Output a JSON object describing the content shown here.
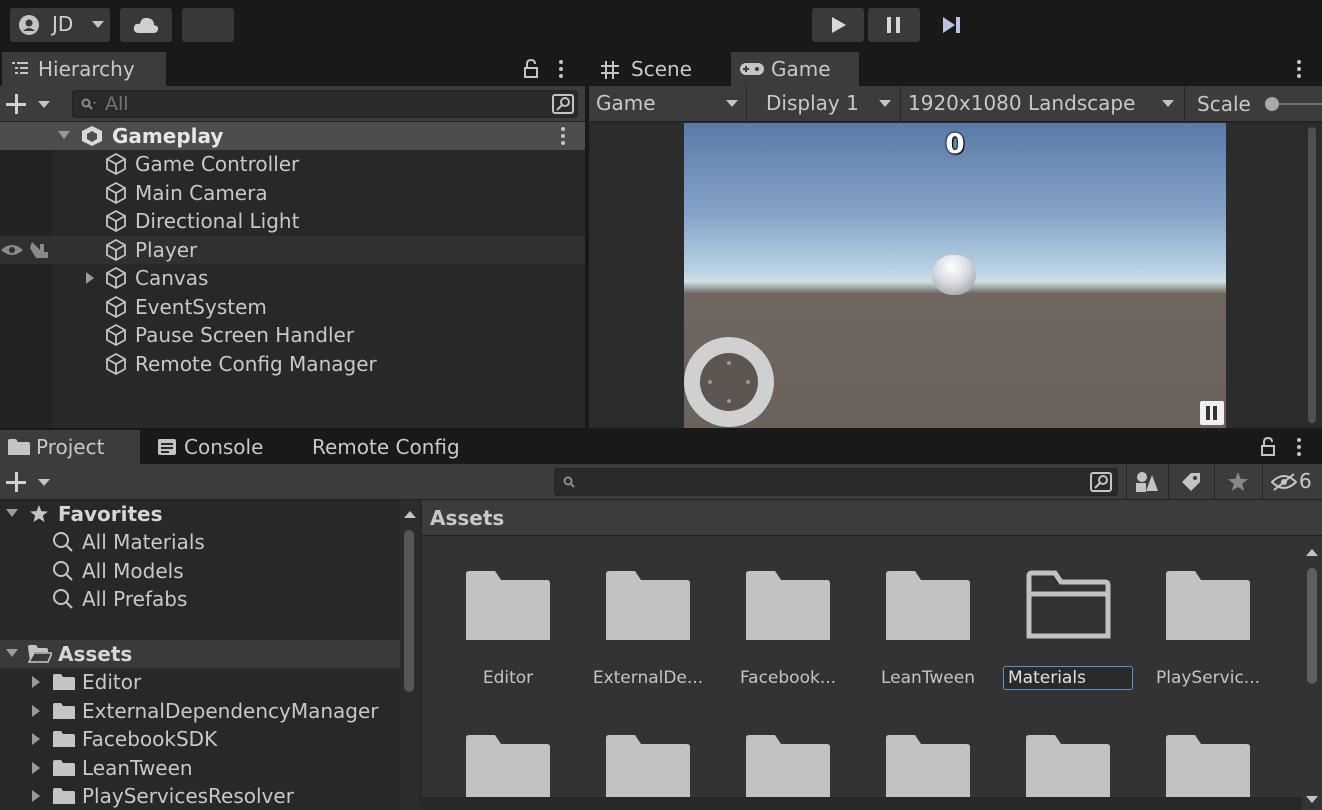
{
  "toolbar": {
    "account_label": "JD"
  },
  "hierarchy": {
    "tab_label": "Hierarchy",
    "search_placeholder": "All",
    "scene_name": "Gameplay",
    "items": [
      {
        "label": "Game Controller"
      },
      {
        "label": "Main Camera"
      },
      {
        "label": "Directional Light"
      },
      {
        "label": "Player"
      },
      {
        "label": "Canvas"
      },
      {
        "label": "EventSystem"
      },
      {
        "label": "Pause Screen Handler"
      },
      {
        "label": "Remote Config Manager"
      }
    ]
  },
  "game_view": {
    "tabs": [
      {
        "label": "Scene"
      },
      {
        "label": "Game"
      }
    ],
    "mode": "Game",
    "display": "Display 1",
    "resolution": "1920x1080 Landscape",
    "scale_label": "Scale",
    "score": "0"
  },
  "project": {
    "tabs": [
      {
        "label": "Project"
      },
      {
        "label": "Console"
      },
      {
        "label": "Remote Config"
      }
    ],
    "hidden_count": "6",
    "favorites_label": "Favorites",
    "favorites": [
      {
        "label": "All Materials"
      },
      {
        "label": "All Models"
      },
      {
        "label": "All Prefabs"
      }
    ],
    "assets_label": "Assets",
    "asset_tree": [
      {
        "label": "Editor"
      },
      {
        "label": "ExternalDependencyManager"
      },
      {
        "label": "FacebookSDK"
      },
      {
        "label": "LeanTween"
      },
      {
        "label": "PlayServicesResolver"
      }
    ],
    "breadcrumb": "Assets",
    "grid": [
      {
        "label": "Editor"
      },
      {
        "label": "ExternalDe..."
      },
      {
        "label": "Facebook..."
      },
      {
        "label": "LeanTween"
      },
      {
        "label": "Materials"
      },
      {
        "label": "PlayServic..."
      }
    ]
  },
  "colors": {
    "background": "#191919",
    "panel": "#383838",
    "folder": "#c2c2c2",
    "selection": "#4d4d4d"
  }
}
